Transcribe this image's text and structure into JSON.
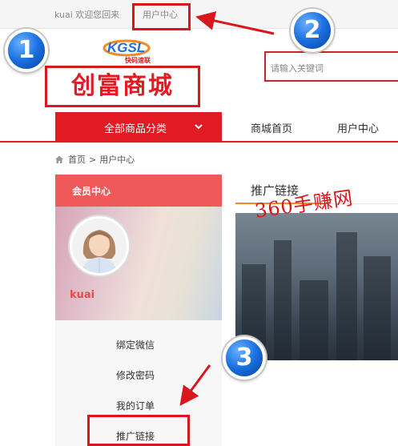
{
  "topbar": {
    "welcome": "kuai 欢迎您回来",
    "user_center_link": "用户中心"
  },
  "header": {
    "logo_text": "KGSL",
    "logo_subtext": "快码速联",
    "brand_name": "创富商城",
    "search_placeholder": "请输入关键词"
  },
  "nav": {
    "all_categories": "全部商品分类",
    "links": [
      "商城首页",
      "用户中心"
    ]
  },
  "breadcrumb": {
    "home": "首页",
    "separator": ">",
    "current": "用户中心"
  },
  "sidebar": {
    "header": "会员中心",
    "username": "kuai",
    "menu": [
      "绑定微信",
      "修改密码",
      "我的订单",
      "推广链接"
    ]
  },
  "main": {
    "title": "推广链接",
    "watermark": "360手赚网"
  },
  "annotations": {
    "badges": [
      "1",
      "2",
      "3"
    ],
    "highlight_color": "#d9161c",
    "badge_color": "#1a6fe0"
  },
  "icons": {
    "home": "home-icon",
    "chevron": "chevron-down-icon"
  },
  "colors": {
    "primary_red": "#e21a24",
    "sidebar_header": "#f0595a",
    "tab_underline": "#f08a24"
  }
}
